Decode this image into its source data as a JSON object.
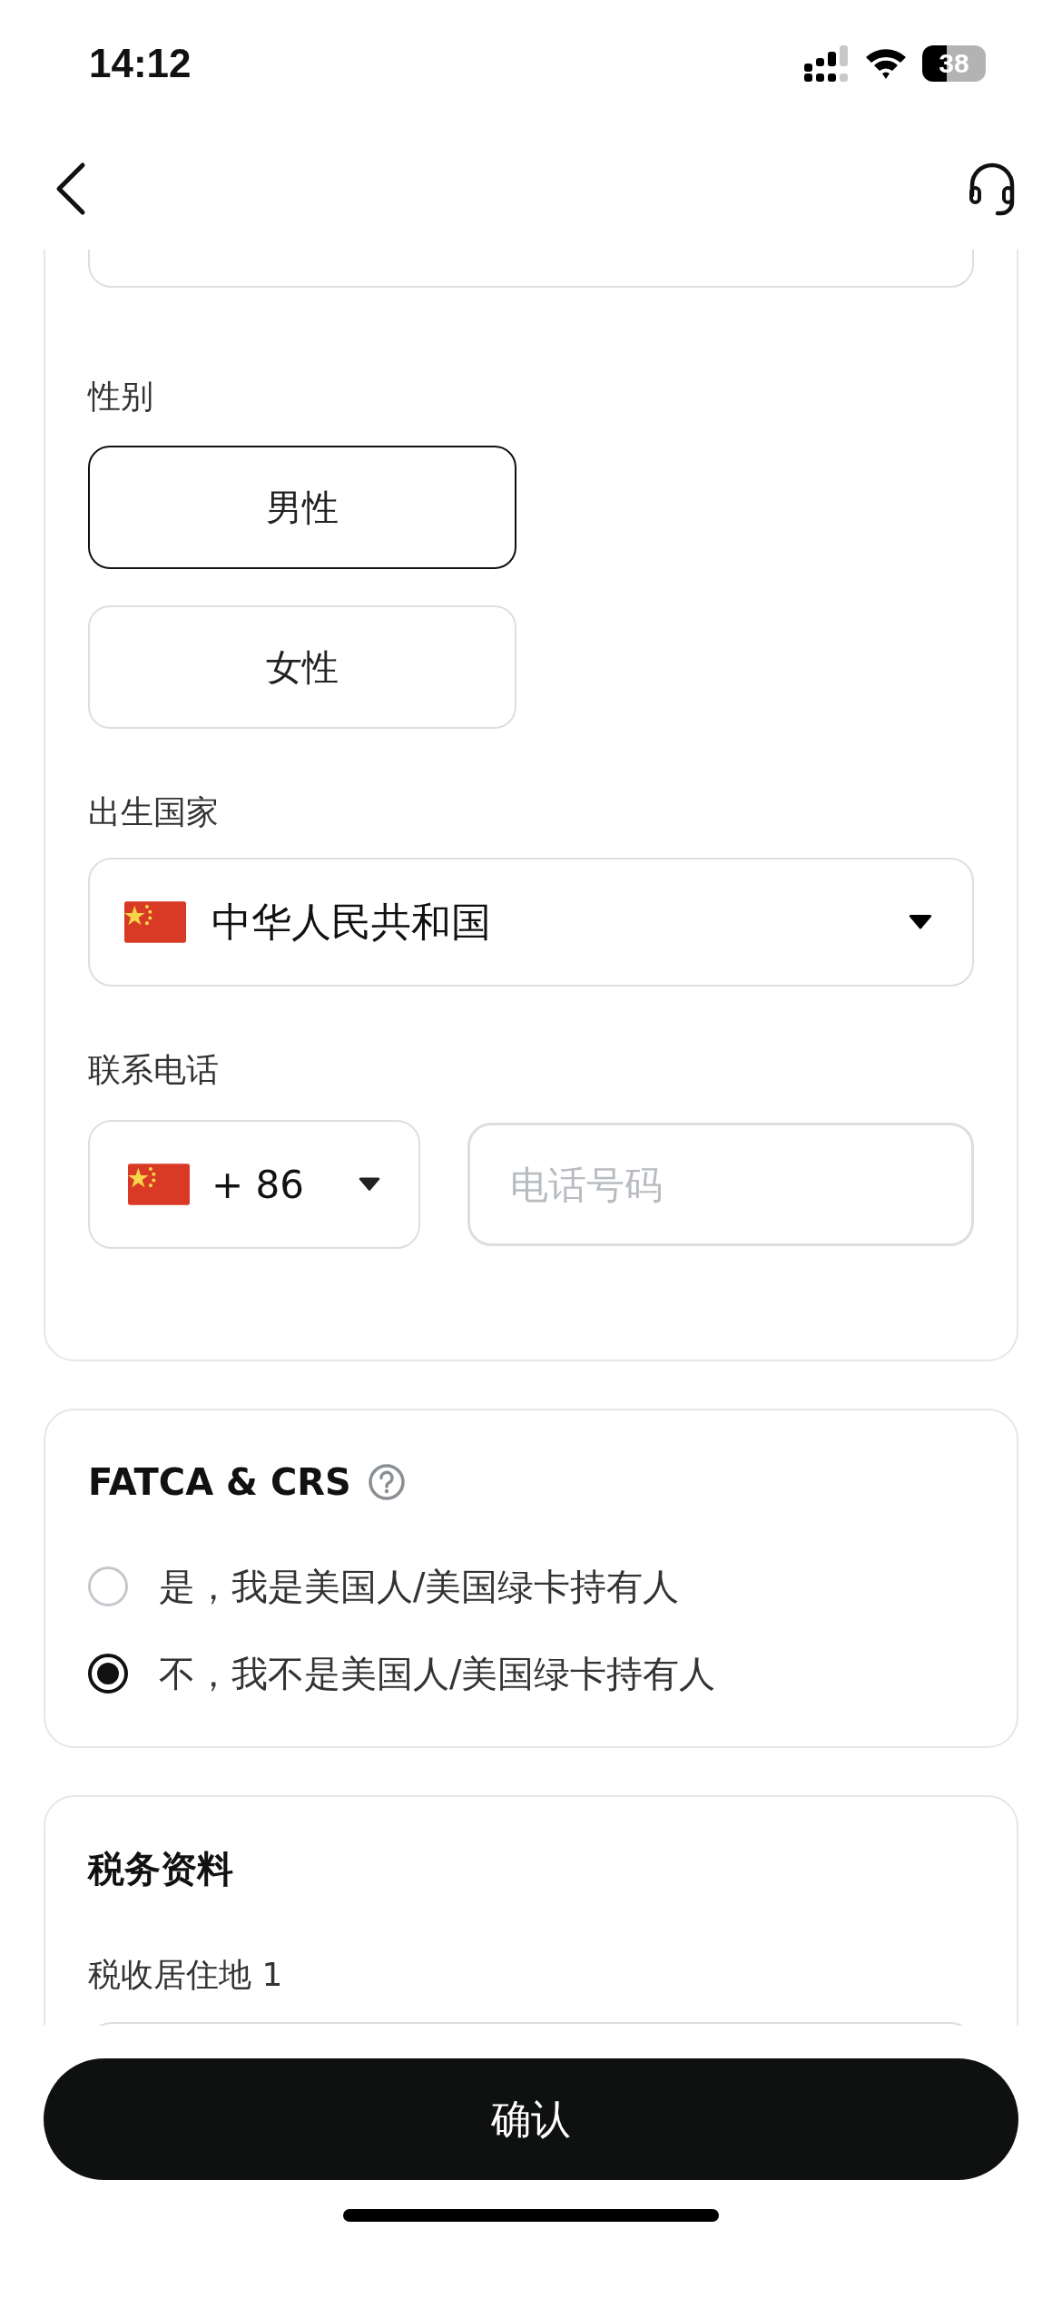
{
  "status_bar": {
    "time": "14:12",
    "battery": "38"
  },
  "gender": {
    "label": "性别",
    "options": [
      {
        "label": "男性",
        "selected": true
      },
      {
        "label": "女性",
        "selected": false
      }
    ]
  },
  "birth_country": {
    "label": "出生国家",
    "value": "中华人民共和国"
  },
  "phone": {
    "label": "联系电话",
    "code": "+ 86",
    "placeholder": "电话号码"
  },
  "fatca": {
    "title": "FATCA & CRS",
    "options": [
      {
        "label": "是，我是美国人/美国绿卡持有人",
        "selected": false
      },
      {
        "label": "不，我不是美国人/美国绿卡持有人",
        "selected": true
      }
    ]
  },
  "tax": {
    "title": "税务资料",
    "residence_label": "税收居住地 1"
  },
  "confirm_button": "确认"
}
